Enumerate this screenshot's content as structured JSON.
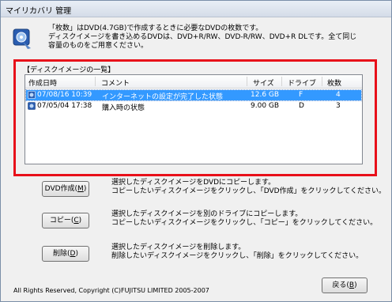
{
  "window": {
    "title": "マイリカバリ 管理"
  },
  "intro": {
    "line1": "「枚数」はDVD(4.7GB)で作成するときに必要なDVDの枚数です。",
    "line2": "ディスクイメージを書き込めるDVDは、DVD+R/RW、DVD-R/RW、DVD+R DLです。全て同じ",
    "line3": "容量のものをご用意ください。"
  },
  "list": {
    "group_title": "【ディスクイメージの一覧】",
    "columns": [
      "作成日時",
      "コメント",
      "サイズ",
      "ドライブ",
      "枚数"
    ],
    "rows": [
      {
        "date": "07/08/16 10:39",
        "comment": "インターネットの設定が完了した状態",
        "size": "12.6 GB",
        "drive": "F",
        "count": "4",
        "selected": true
      },
      {
        "date": "07/05/04 17:38",
        "comment": "購入時の状態",
        "size": "9.00 GB",
        "drive": "D",
        "count": "3",
        "selected": false
      }
    ]
  },
  "actions": [
    {
      "label": "DVD作成",
      "key": "M",
      "desc1": "選択したディスクイメージをDVDにコピーします。",
      "desc2": "コピーしたいディスクイメージをクリックし、「DVD作成」をクリックしてください。"
    },
    {
      "label": "コピー",
      "key": "C",
      "desc1": "選択したディスクイメージを別のドライブにコピーします。",
      "desc2": "コピーしたいディスクイメージをクリックし、「コピー」をクリックしてください。"
    },
    {
      "label": "削除",
      "key": "D",
      "desc1": "選択したディスクイメージを削除します。",
      "desc2": "削除したいディスクイメージをクリックし、「削除」をクリックしてください。"
    }
  ],
  "footer": {
    "copyright": "All Rights Reserved, Copyright (C)FUJITSU LIMITED 2005-2007",
    "back_label": "戻る",
    "back_key": "B"
  },
  "colors": {
    "highlight": "#e8101a",
    "selection": "#3399ff"
  },
  "icons": {
    "app": "recovery-disk-icon",
    "row": "disk-image-icon"
  }
}
